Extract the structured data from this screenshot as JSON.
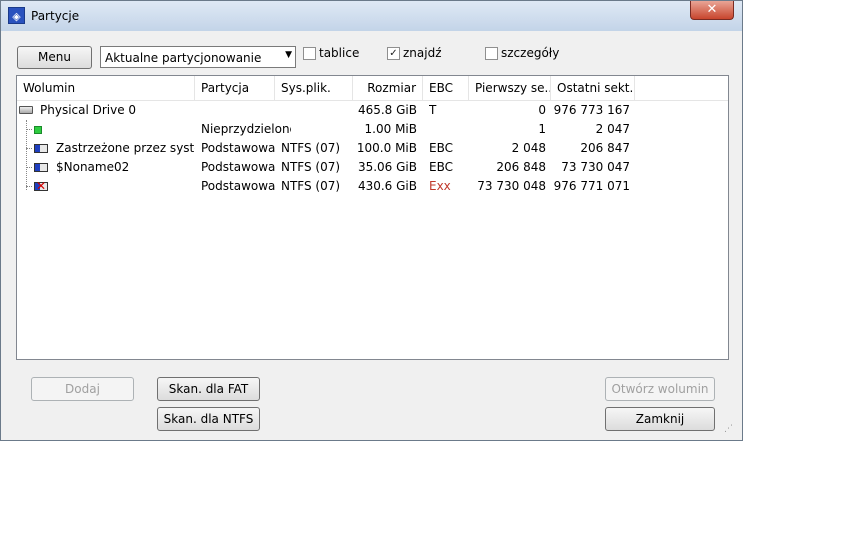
{
  "window": {
    "title": "Partycje"
  },
  "toolbar": {
    "menu_label": "Menu",
    "view_select": "Aktualne partycjonowanie",
    "checkboxes": [
      {
        "label": "tablice",
        "checked": false
      },
      {
        "label": "znajdź",
        "checked": true
      },
      {
        "label": "szczegóły",
        "checked": false
      }
    ]
  },
  "list": {
    "columns": [
      "Wolumin",
      "Partycja",
      "Sys.plik.",
      "Rozmiar",
      "EBC",
      "Pierwszy se...",
      "Ostatni sekt..."
    ],
    "rows": [
      {
        "icon": "physical-drive-icon",
        "volume": "Physical Drive 0",
        "partition": "",
        "fs": "",
        "size": "465.8 GiB",
        "ebc": "T",
        "first": "0",
        "last": "976 773 167"
      },
      {
        "icon": "unallocated-icon",
        "volume": "",
        "partition": "Nieprzydzielone",
        "fs": "",
        "size": "1.00 MiB",
        "ebc": "",
        "first": "1",
        "last": "2 047"
      },
      {
        "icon": "partition-icon",
        "volume": "Zastrzeżone przez system",
        "partition": "Podstawowa",
        "fs": "NTFS (07)",
        "size": "100.0 MiB",
        "ebc": "EBC",
        "first": "2 048",
        "last": "206 847"
      },
      {
        "icon": "partition-icon",
        "volume": "$Noname02",
        "partition": "Podstawowa",
        "fs": "NTFS (07)",
        "size": "35.06 GiB",
        "ebc": "EBC",
        "first": "206 848",
        "last": "73 730 047"
      },
      {
        "icon": "missing-partition-icon",
        "volume": "",
        "partition": "Podstawowa",
        "fs": "NTFS (07)",
        "size": "430.6 GiB",
        "ebc": "Exx",
        "first": "73 730 048",
        "last": "976 771 071"
      }
    ]
  },
  "buttons": {
    "add": "Dodaj",
    "scan_fat": "Skan. dla FAT",
    "scan_ntfs": "Skan. dla NTFS",
    "open_volume": "Otwórz wolumin",
    "close": "Zamknij"
  },
  "colors": {
    "ebc_error": "#c0392b",
    "unallocated": "#2ecc40",
    "partition": "#1f3fbf"
  }
}
